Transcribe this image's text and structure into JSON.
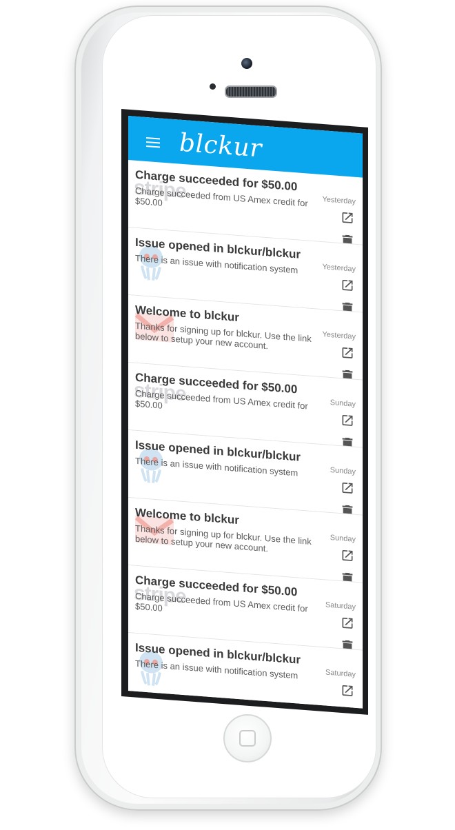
{
  "app": {
    "logo_text": "blckur",
    "header_color": "#0aa6ee"
  },
  "notifications": [
    {
      "title": "Charge succeeded for $50.00",
      "body": "Charge succeeded from US Amex credit for $50.00",
      "time": "Yesterday",
      "source_icon": "stripe-icon",
      "watermark_text": "stripe"
    },
    {
      "title": "Issue opened in blckur/blckur",
      "body": "There is an issue with notification system",
      "time": "Yesterday",
      "source_icon": "github-octocat-icon",
      "watermark_text": ""
    },
    {
      "title": "Welcome to blckur",
      "body": "Thanks for signing up for blckur. Use the link below to setup your new account.",
      "time": "Yesterday",
      "source_icon": "gmail-icon",
      "watermark_text": ""
    },
    {
      "title": "Charge succeeded for $50.00",
      "body": "Charge succeeded from US Amex credit for $50.00",
      "time": "Sunday",
      "source_icon": "stripe-icon",
      "watermark_text": "stripe"
    },
    {
      "title": "Issue opened in blckur/blckur",
      "body": "There is an issue with notification system",
      "time": "Sunday",
      "source_icon": "github-octocat-icon",
      "watermark_text": ""
    },
    {
      "title": "Welcome to blckur",
      "body": "Thanks for signing up for blckur. Use the link below to setup your new account.",
      "time": "Sunday",
      "source_icon": "gmail-icon",
      "watermark_text": ""
    },
    {
      "title": "Charge succeeded for $50.00",
      "body": "Charge succeeded from US Amex credit for $50.00",
      "time": "Saturday",
      "source_icon": "stripe-icon",
      "watermark_text": "stripe"
    },
    {
      "title": "Issue opened in blckur/blckur",
      "body": "There is an issue with notification system",
      "time": "Saturday",
      "source_icon": "github-octocat-icon",
      "watermark_text": ""
    }
  ],
  "icons": {
    "menu": "menu-icon",
    "open": "open-in-new-icon",
    "delete": "trash-icon"
  }
}
